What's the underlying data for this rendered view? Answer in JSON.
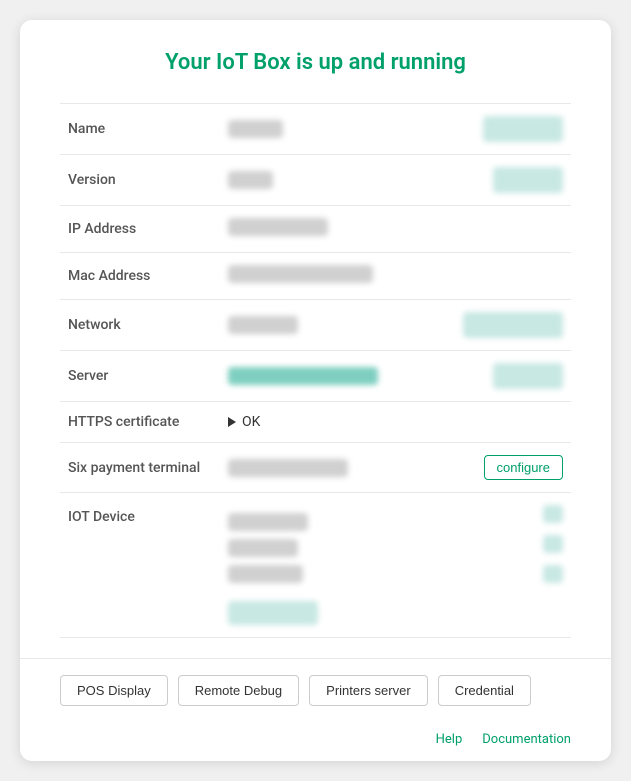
{
  "page": {
    "title": "Your IoT Box is up and running"
  },
  "fields": {
    "name_label": "Name",
    "version_label": "Version",
    "ip_label": "IP Address",
    "mac_label": "Mac Address",
    "network_label": "Network",
    "server_label": "Server",
    "https_label": "HTTPS certificate",
    "six_label": "Six payment terminal",
    "iot_label": "IOT Device",
    "https_status": "OK",
    "configure_btn": "configure"
  },
  "footer_buttons": {
    "pos_display": "POS Display",
    "remote_debug": "Remote Debug",
    "printers_server": "Printers server",
    "credential": "Credential"
  },
  "footer_links": {
    "help": "Help",
    "documentation": "Documentation"
  }
}
